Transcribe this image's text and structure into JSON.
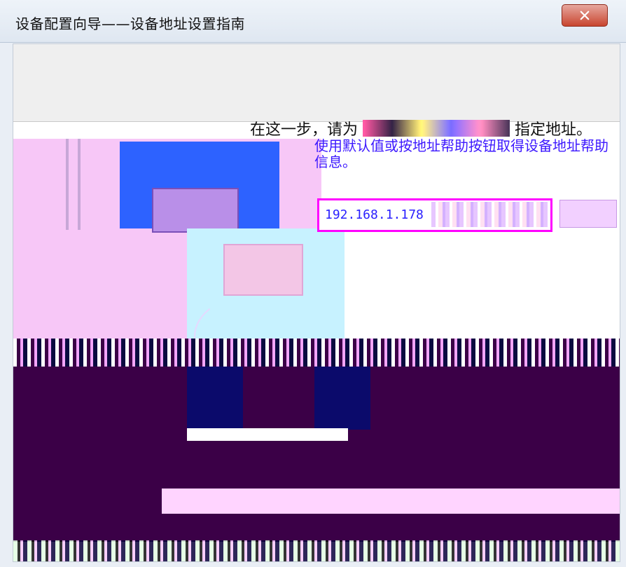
{
  "window": {
    "title": "设备配置向导——设备地址设置指南",
    "close_symbol": "X"
  },
  "content": {
    "prompt_prefix": "在这一步，请为",
    "prompt_suffix": "指定地址。",
    "help_text": "使用默认值或按地址帮助按钮取得设备地址帮助信息。",
    "address_value": "192.168.1.178"
  },
  "icons": {
    "close": "close-icon",
    "computer": "computer-icon",
    "monitor": "monitor-icon"
  },
  "colors": {
    "title_bar": "#e7eef7",
    "close_button": "#c8452f",
    "blue_text": "#3c18ff",
    "address_border": "#ff00ff"
  }
}
